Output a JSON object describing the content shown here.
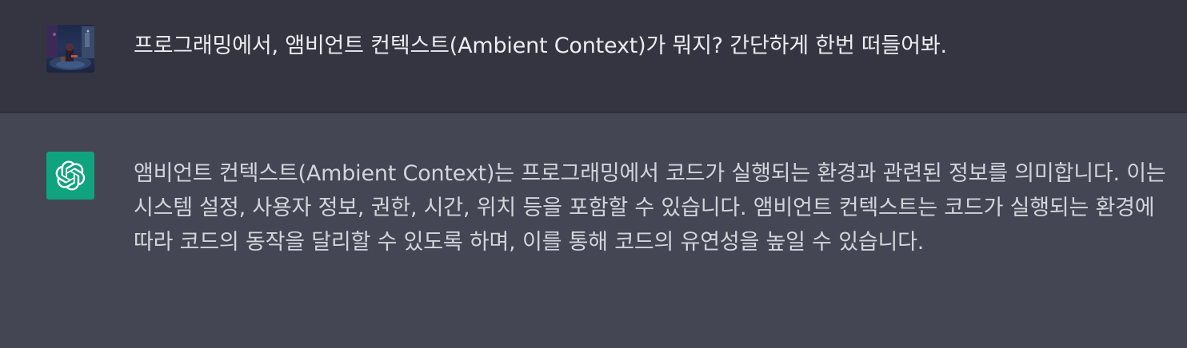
{
  "conversation": {
    "user_message": {
      "avatar_icon": "user-photo-avatar-icon",
      "text": "프로그래밍에서, 앰비언트 컨텍스트(Ambient Context)가 뭐지? 간단하게 한번 떠들어봐."
    },
    "assistant_message": {
      "avatar_icon": "openai-logo-icon",
      "text": "앰비언트 컨텍스트(Ambient Context)는 프로그래밍에서 코드가 실행되는 환경과 관련된 정보를 의미합니다. 이는 시스템 설정, 사용자 정보, 권한, 시간, 위치 등을 포함할 수 있습니다. 앰비언트 컨텍스트는 코드가 실행되는 환경에 따라 코드의 동작을 달리할 수 있도록 하며, 이를 통해 코드의 유연성을 높일 수 있습니다."
    }
  },
  "colors": {
    "user_row_bg": "#343541",
    "assistant_row_bg": "#444654",
    "assistant_avatar_bg": "#10a37f",
    "text": "#ececf1"
  }
}
